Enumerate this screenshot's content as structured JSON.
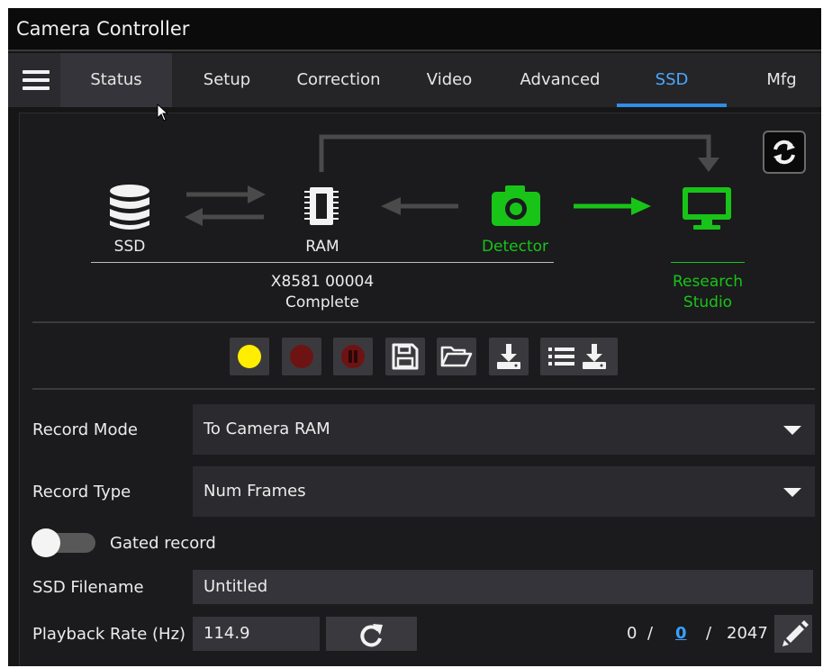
{
  "window": {
    "title": "Camera Controller"
  },
  "tabs": [
    {
      "label": "Status"
    },
    {
      "label": "Setup"
    },
    {
      "label": "Correction"
    },
    {
      "label": "Video"
    },
    {
      "label": "Advanced"
    },
    {
      "label": "SSD",
      "active": true
    },
    {
      "label": "Mfg"
    }
  ],
  "diagram": {
    "ssd_label": "SSD",
    "ram_label": "RAM",
    "detector_label": "Detector",
    "research_studio_label_line1": "Research",
    "research_studio_label_line2": "Studio",
    "ram_status_line1": "X8581 00004",
    "ram_status_line2": "Complete",
    "active_color": "#18c418",
    "inactive_color": "#4a4a4a"
  },
  "toolbar": {
    "buttons": [
      {
        "icon": "record-arm-icon",
        "color": "#ffee00"
      },
      {
        "icon": "record-icon",
        "color": "#6e1313"
      },
      {
        "icon": "pause-icon",
        "color": "#6e1313"
      },
      {
        "icon": "save-icon"
      },
      {
        "icon": "open-folder-icon"
      },
      {
        "icon": "download-icon"
      },
      {
        "icon": "list-download-icon"
      }
    ]
  },
  "form": {
    "record_mode": {
      "label": "Record Mode",
      "value": "To Camera RAM"
    },
    "record_type": {
      "label": "Record Type",
      "value": "Num Frames"
    },
    "gated_record": {
      "label": "Gated record",
      "checked": false
    },
    "ssd_filename": {
      "label": "SSD Filename",
      "value": "Untitled"
    },
    "playback_rate": {
      "label": "Playback Rate (Hz)",
      "value": "114.9"
    }
  },
  "frames": {
    "start": "0",
    "current": "0",
    "end": "2047",
    "separator": "/"
  },
  "colors": {
    "accent": "#2f8ee6",
    "background": "#1b1b1d"
  }
}
